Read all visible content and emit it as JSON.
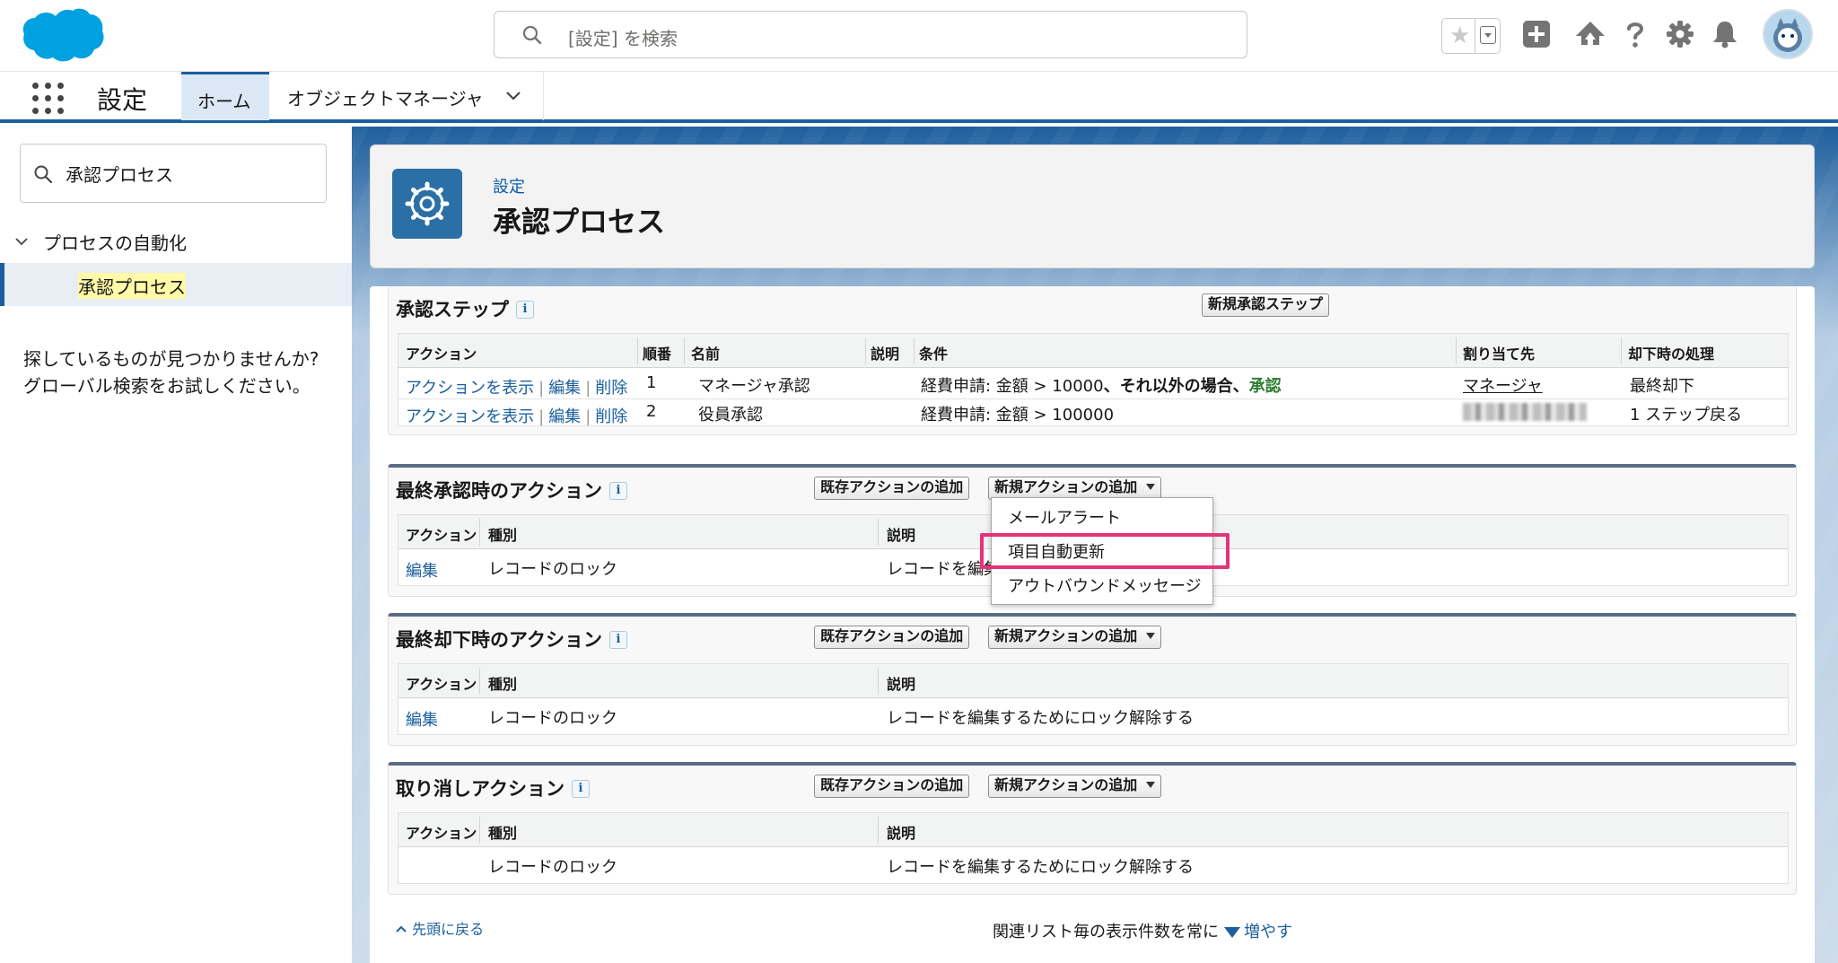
{
  "header": {
    "search_placeholder": "[設定] を検索",
    "icons": [
      "star-icon",
      "chevron-down-icon",
      "add-icon",
      "trailhead-icon",
      "help-icon",
      "gear-icon",
      "bell-icon",
      "avatar"
    ]
  },
  "nav": {
    "app_name": "設定",
    "tabs": [
      {
        "label": "ホーム",
        "active": true
      },
      {
        "label": "オブジェクトマネージャ",
        "active": false
      }
    ]
  },
  "sidebar": {
    "search_value": "承認プロセス",
    "group_label": "プロセスの自動化",
    "item_label": "承認プロセス",
    "help_text_1": "探しているものが見つかりませんか?",
    "help_text_2": "グローバル検索をお試しください。"
  },
  "page": {
    "breadcrumb": "設定",
    "title": "承認プロセス"
  },
  "steps": {
    "title": "承認ステップ",
    "new_button": "新規承認ステップ",
    "columns": [
      "アクション",
      "順番",
      "名前",
      "説明",
      "条件",
      "割り当て先",
      "却下時の処理"
    ],
    "rows": [
      {
        "actions": [
          "アクションを表示",
          "編集",
          "削除"
        ],
        "order": "1",
        "name": "マネージャ承認",
        "description": "",
        "condition": "経費申請: 金額 > 10000",
        "condition_suffix": "、それ以外の場合、",
        "condition_result": "承認",
        "assignee": "マネージャ",
        "reject": "最終却下"
      },
      {
        "actions": [
          "アクションを表示",
          "編集",
          "削除"
        ],
        "order": "2",
        "name": "役員承認",
        "description": "",
        "condition": "経費申請: 金額 > 100000",
        "condition_suffix": "",
        "condition_result": "",
        "assignee": "",
        "reject": "1 ステップ戻る"
      }
    ]
  },
  "sections": [
    {
      "title": "最終承認時のアクション",
      "existing_button": "既存アクションの追加",
      "new_button": "新規アクションの追加",
      "columns": [
        "アクション",
        "種別",
        "説明"
      ],
      "row": {
        "action": "編集",
        "type": "レコードのロック",
        "description": "レコードを編集"
      }
    },
    {
      "title": "最終却下時のアクション",
      "existing_button": "既存アクションの追加",
      "new_button": "新規アクションの追加",
      "columns": [
        "アクション",
        "種別",
        "説明"
      ],
      "row": {
        "action": "編集",
        "type": "レコードのロック",
        "description": "レコードを編集するためにロック解除する"
      }
    },
    {
      "title": "取り消しアクション",
      "existing_button": "既存アクションの追加",
      "new_button": "新規アクションの追加",
      "columns": [
        "アクション",
        "種別",
        "説明"
      ],
      "row": {
        "action": "",
        "type": "レコードのロック",
        "description": "レコードを編集するためにロック解除する"
      }
    }
  ],
  "dropdown": {
    "options": [
      "メールアラート",
      "項目自動更新",
      "アウトバウンドメッセージ"
    ],
    "highlighted_index": 1
  },
  "footer": {
    "back_to_top": "先頭に戻る",
    "related_text": "関連リスト毎の表示件数を常に",
    "increase_link": "増やす"
  },
  "colors": {
    "brand": "#1b5f9e",
    "link": "#1b5f9e",
    "highlight": "#e6327a",
    "approved": "#2e7d32"
  }
}
